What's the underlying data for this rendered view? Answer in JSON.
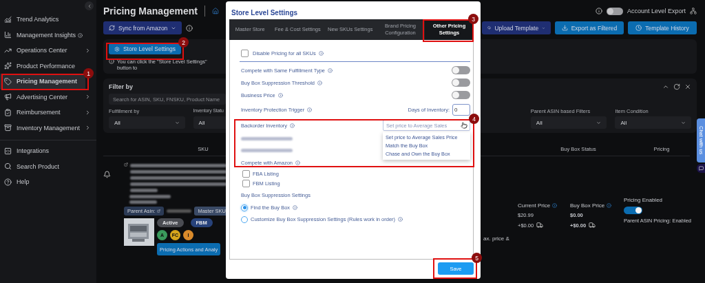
{
  "sidebar": {
    "items": [
      {
        "label": "Trend Analytics",
        "expandable": false,
        "info": false,
        "selected": false
      },
      {
        "label": "Management Insights",
        "expandable": false,
        "info": true,
        "selected": false
      },
      {
        "label": "Operations Center",
        "expandable": true,
        "info": false,
        "selected": false
      },
      {
        "label": "Product Performance",
        "expandable": false,
        "info": false,
        "selected": false
      },
      {
        "label": "Pricing Management",
        "expandable": false,
        "info": false,
        "selected": true
      },
      {
        "label": "Advertising Center",
        "expandable": true,
        "info": false,
        "selected": false
      },
      {
        "label": "Reimbursement",
        "expandable": true,
        "info": false,
        "selected": false
      },
      {
        "label": "Inventory Management",
        "expandable": true,
        "info": false,
        "selected": false
      }
    ],
    "footer_items": [
      {
        "label": "Integrations",
        "selected": false
      },
      {
        "label": "Search Product",
        "selected": false
      },
      {
        "label": "Help",
        "selected": false
      }
    ]
  },
  "header": {
    "title": "Pricing Management",
    "account_export": {
      "label": "Account Level Export",
      "on": false
    }
  },
  "toolbar": {
    "sync_button": "Sync from Amazon",
    "buttons": [
      {
        "label": "Upload Template",
        "kind": "dropdown"
      },
      {
        "label": "Export as Filtered",
        "kind": "export"
      },
      {
        "label": "Template History",
        "kind": "history"
      }
    ]
  },
  "settings_card": {
    "button": "Store Level Settings",
    "note": "You can click the \"Store Level Settings\" button to"
  },
  "filters": {
    "title": "Filter by",
    "search": {
      "placeholder": "Search for ASIN, SKU, FNSKU, Product Name"
    },
    "fields": [
      {
        "label": "Fulfillment by",
        "value": "All"
      },
      {
        "label": "Inventory Statu",
        "value": "All"
      },
      {
        "label": "Parent ASIN based Filters",
        "value": "All"
      },
      {
        "label": "Item Condition",
        "value": "All"
      }
    ]
  },
  "table": {
    "columns": [
      "SKU",
      "Buy Box Status",
      "Pricing"
    ],
    "row": {
      "parent_asin_label": "Parent Asin:",
      "master_sku": "Master SKU",
      "status": "Active",
      "fulfillment": "FBM",
      "badges": [
        {
          "text": "A",
          "color": "#3a9a5c"
        },
        {
          "text": "FC",
          "color": "#d6a51c"
        },
        {
          "text": "I",
          "color": "#d98a2b"
        }
      ],
      "action_button": "Pricing Actions and Analy",
      "trailing_text": "ax. price &",
      "current_price": {
        "label": "Current Price",
        "price": "$20.99",
        "shipping": "+$0.00"
      },
      "buy_box_price": {
        "label": "Buy Box Price",
        "price": "$0.00",
        "shipping": "+$0.00"
      },
      "pricing_enabled": {
        "label": "Pricing Enabled",
        "on": true,
        "note": "Parent ASIN Pricing: Enabled"
      }
    }
  },
  "modal": {
    "title": "Store Level Settings",
    "tabs": [
      {
        "label": "Master Store",
        "selected": false
      },
      {
        "label": "Fee & Cost Settings",
        "selected": false
      },
      {
        "label": "New SKUs Settings",
        "selected": false
      },
      {
        "label": "Brand Pricing Configuration",
        "selected": false
      },
      {
        "label": "Other Pricing Settings",
        "selected": true
      }
    ],
    "disable_all": {
      "label": "Disable Pricing for all SKUs",
      "checked": false
    },
    "toggles": [
      {
        "label": "Compete with Same Fulfillment Type",
        "on": false
      },
      {
        "label": "Buy Box Suppression Threshold",
        "on": false
      },
      {
        "label": "Business Price",
        "on": false
      }
    ],
    "inventory_protection": {
      "label": "Inventory Protection Trigger",
      "days_label": "Days of Inventory:",
      "days_value": "0"
    },
    "backorder": {
      "label": "Backorder Inventory",
      "placeholder": "Set price to Average Sales",
      "expanded": true,
      "options": [
        "Set price to Average Sales Price",
        "Match the Buy Box",
        "Chase and Own the Buy Box"
      ]
    },
    "compete_amazon": {
      "label": "Compete with Amazon",
      "options": [
        {
          "label": "FBA Listing",
          "checked": false
        },
        {
          "label": "FBM Listing",
          "checked": false
        }
      ]
    },
    "suppression": {
      "title": "Buy Box Suppression Settings",
      "options": [
        {
          "label": "Find the Buy Box",
          "selected": true
        },
        {
          "label": "Customize Buy Box Suppression Settings (Rules work in order)",
          "selected": false
        }
      ]
    },
    "save": "Save"
  },
  "annotations": [
    {
      "number": "1"
    },
    {
      "number": "2"
    },
    {
      "number": "3"
    },
    {
      "number": "4"
    },
    {
      "number": "5"
    }
  ],
  "chat": {
    "label": "Chat with us"
  }
}
